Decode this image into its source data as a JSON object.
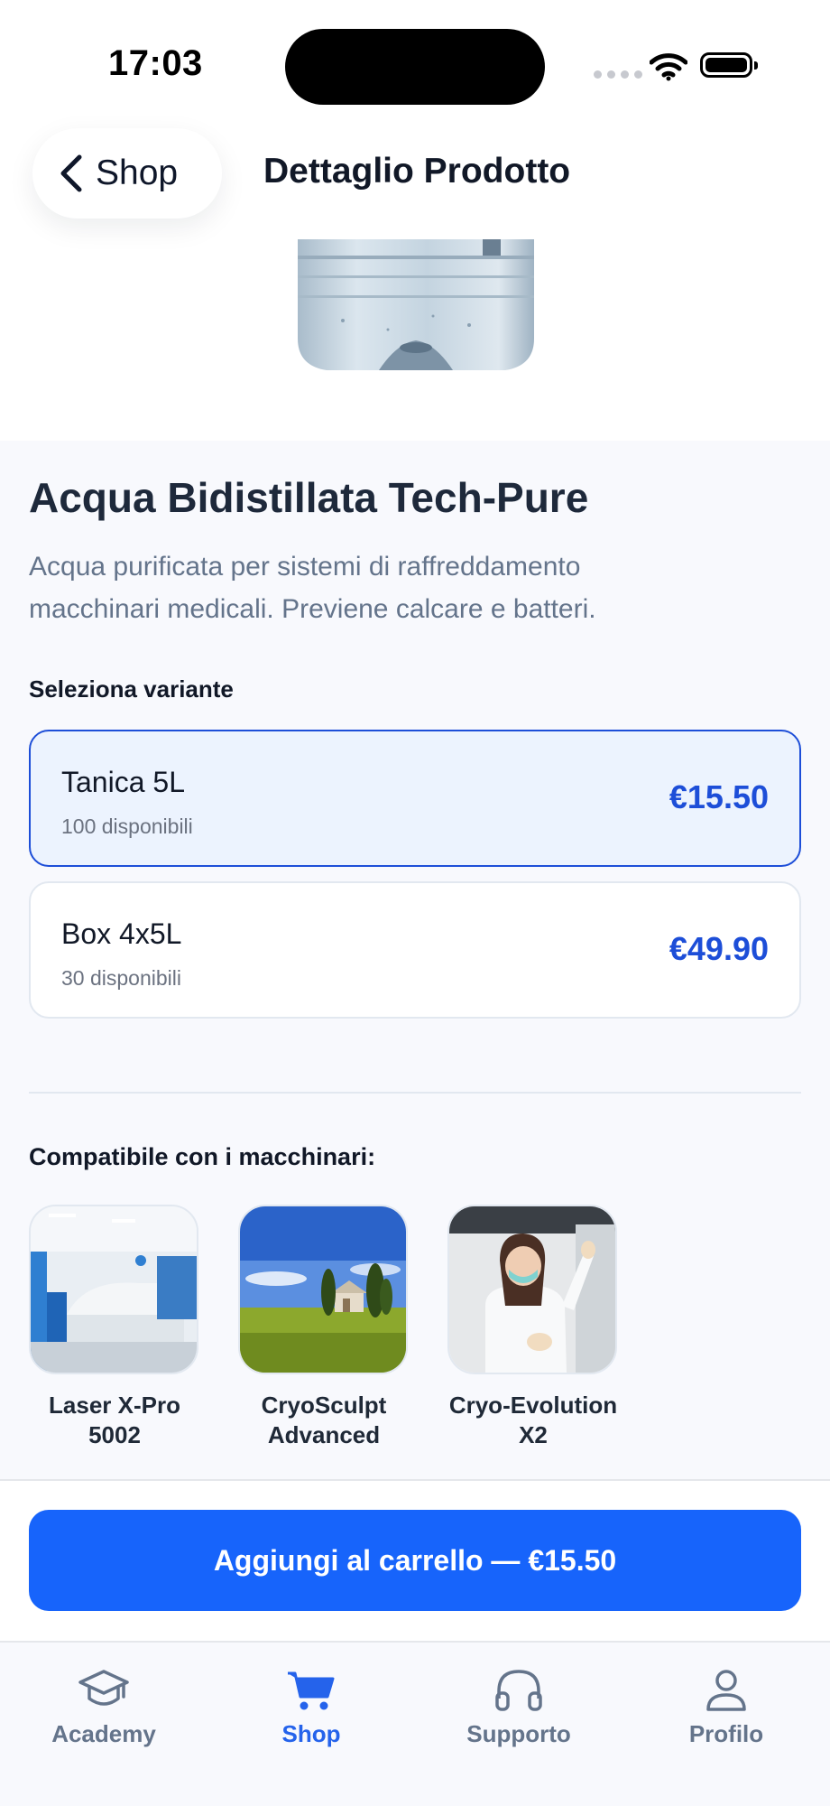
{
  "status_bar": {
    "time": "17:03"
  },
  "header": {
    "back_label": "Shop",
    "title": "Dettaglio Prodotto"
  },
  "product": {
    "title": "Acqua Bidistillata Tech-Pure",
    "description": "Acqua purificata per sistemi di raffreddamento macchinari medicali. Previene calcare e batteri."
  },
  "variants": {
    "label": "Seleziona variante",
    "items": [
      {
        "name": "Tanica 5L",
        "stock": "100 disponibili",
        "price": "€15.50",
        "selected": true
      },
      {
        "name": "Box 4x5L",
        "stock": "30 disponibili",
        "price": "€49.90",
        "selected": false
      }
    ]
  },
  "compatible": {
    "label": "Compatibile con i macchinari:",
    "items": [
      {
        "name": "Laser X-Pro 5002"
      },
      {
        "name": "CryoSculpt Advanced"
      },
      {
        "name": "Cryo-Evolution X2"
      }
    ]
  },
  "cart": {
    "button_label": "Aggiungi al carrello — €15.50"
  },
  "tabbar": {
    "items": [
      {
        "label": "Academy",
        "icon": "graduation-cap-icon",
        "active": false
      },
      {
        "label": "Shop",
        "icon": "cart-icon",
        "active": true
      },
      {
        "label": "Supporto",
        "icon": "headphones-icon",
        "active": false
      },
      {
        "label": "Profilo",
        "icon": "user-icon",
        "active": false
      }
    ]
  },
  "colors": {
    "accent": "#1764fb",
    "price": "#1d4ed8",
    "inactive_tab": "#64748b"
  }
}
